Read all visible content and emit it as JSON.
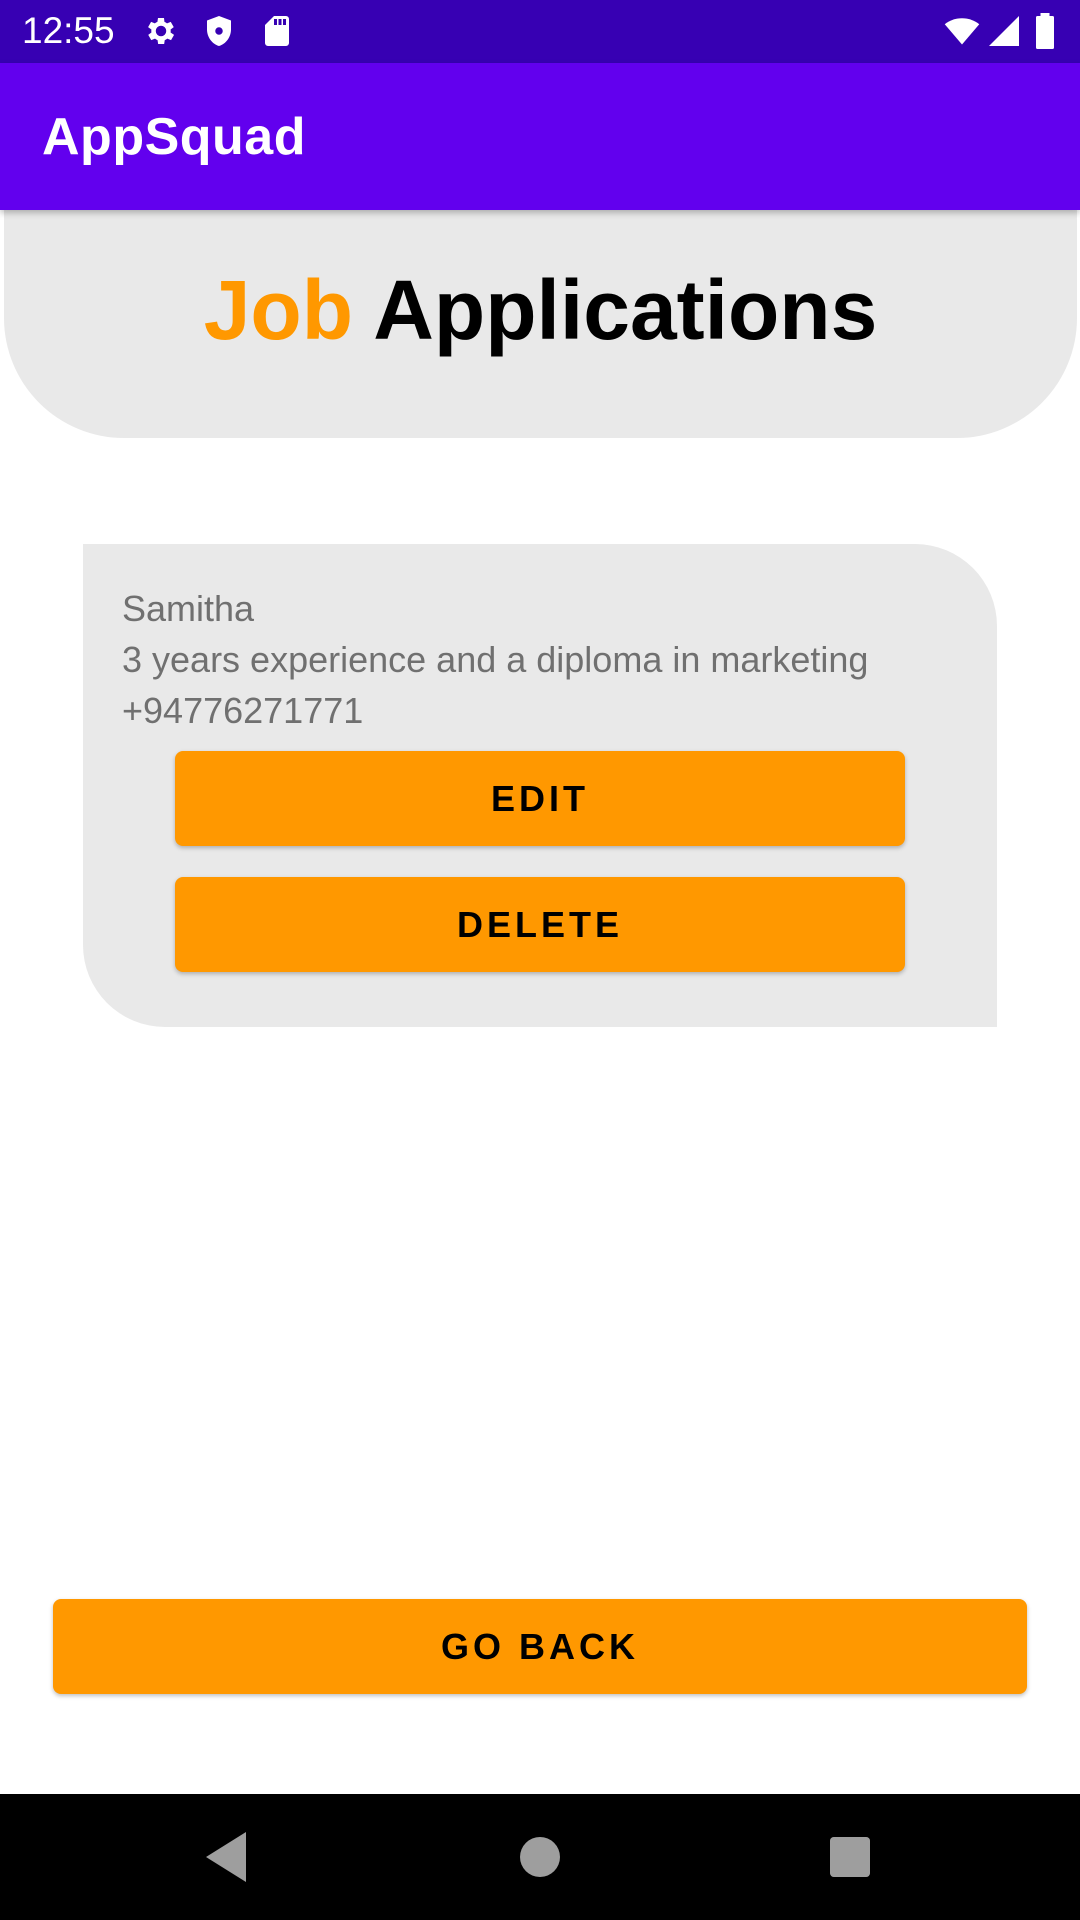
{
  "status_bar": {
    "time": "12:55",
    "left_icons": [
      "gear-icon",
      "shield-icon",
      "sd-card-icon"
    ],
    "right_icons": [
      "wifi-icon",
      "signal-icon",
      "battery-icon"
    ]
  },
  "app_bar": {
    "title": "AppSquad"
  },
  "header": {
    "accent_word": "Job",
    "rest": "Applications"
  },
  "application": {
    "name": "Samitha",
    "description": "3 years experience and a diploma in marketing",
    "phone": "+94776271771",
    "edit_label": "EDIT",
    "delete_label": "DELETE"
  },
  "footer": {
    "go_back_label": "GO BACK"
  },
  "nav_bar": {
    "icons": [
      "back-icon",
      "home-icon",
      "recents-icon"
    ]
  },
  "colors": {
    "status_bar": "#3700B3",
    "app_bar": "#6200EE",
    "accent": "#FF9800",
    "panel": "#E9E9E9",
    "card_text": "#707070"
  }
}
